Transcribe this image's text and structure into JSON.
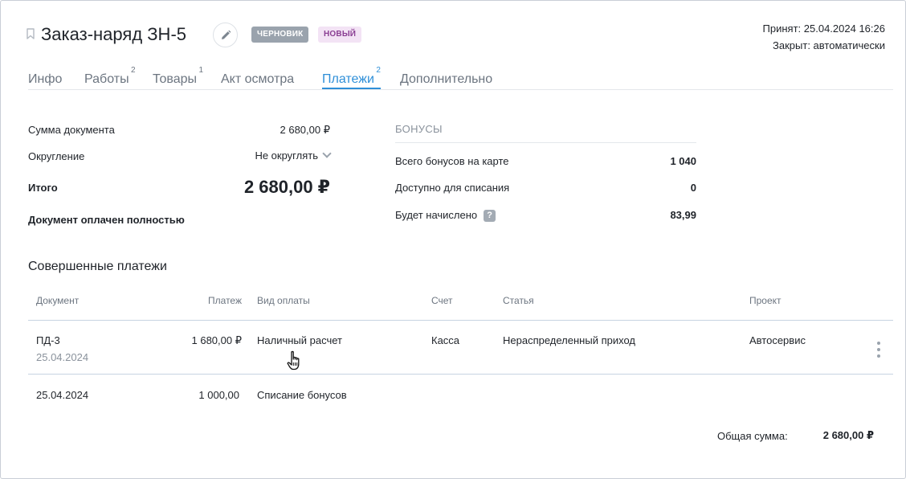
{
  "header": {
    "title": "Заказ-наряд ЗН-5",
    "badges": {
      "draft": "ЧЕРНОВИК",
      "new": "НОВЫЙ"
    },
    "accepted": "Принят: 25.04.2024 16:26",
    "closed": "Закрыт: автоматически"
  },
  "tabs": [
    {
      "label": "Инфо",
      "count": ""
    },
    {
      "label": "Работы",
      "count": "2"
    },
    {
      "label": "Товары",
      "count": "1"
    },
    {
      "label": "Акт осмотра",
      "count": ""
    },
    {
      "label": "Платежи",
      "count": "2",
      "active": true
    },
    {
      "label": "Дополнительно",
      "count": ""
    }
  ],
  "summary": {
    "doc_sum_label": "Сумма документа",
    "doc_sum_value": "2 680,00 ₽",
    "rounding_label": "Округление",
    "rounding_value": "Не округлять",
    "total_label": "Итого",
    "total_value": "2 680,00 ₽",
    "status": "Документ оплачен полностью"
  },
  "bonuses": {
    "title": "БОНУСЫ",
    "rows": [
      {
        "label": "Всего бонусов на карте",
        "value": "1 040"
      },
      {
        "label": "Доступно для списания",
        "value": "0"
      },
      {
        "label": "Будет начислено",
        "value": "83,99",
        "help": "?"
      }
    ]
  },
  "payments": {
    "title": "Совершенные платежи",
    "columns": {
      "document": "Документ",
      "amount": "Платеж",
      "method": "Вид оплаты",
      "account": "Счет",
      "article": "Статья",
      "project": "Проект"
    },
    "rows": [
      {
        "document": "ПД-3",
        "date": "25.04.2024",
        "amount": "1 680,00 ₽",
        "method": "Наличный расчет",
        "account": "Касса",
        "article": "Нераспределенный приход",
        "project": "Автосервис"
      },
      {
        "document": "25.04.2024",
        "amount": "1 000,00",
        "method": "Списание бонусов"
      }
    ],
    "total_label": "Общая сумма:",
    "total_value": "2 680,00 ₽"
  },
  "colors": {
    "accent": "#2f8fd8",
    "draft_badge": "#9aa3ad",
    "new_badge_bg": "#f3e3f5",
    "new_badge_text": "#8a3e93"
  },
  "icons": {
    "bookmark": "bookmark-icon",
    "edit": "pencil-icon",
    "help": "question-icon",
    "more": "more-vertical-icon",
    "cursor": "hand-pointer-icon"
  }
}
